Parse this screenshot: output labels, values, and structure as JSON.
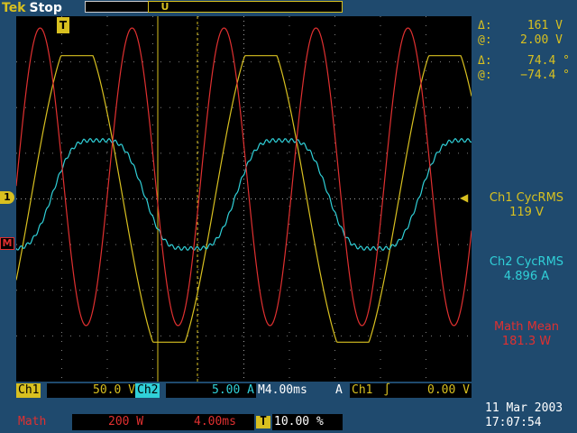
{
  "header": {
    "brand": "Tek",
    "state": "Stop",
    "trigger_position_marker": "U"
  },
  "markers": {
    "trigger": "T",
    "ch1_ground": "1",
    "math_ground": "M"
  },
  "cursors": {
    "delta_voltage_symbol": "Δ:",
    "delta_voltage": "161 V",
    "at_voltage_symbol": "@:",
    "at_voltage": "2.00 V",
    "delta_phase_symbol": "Δ:",
    "delta_phase": "74.4 °",
    "at_phase_symbol": "@:",
    "at_phase": "−74.4 °"
  },
  "measurements": [
    {
      "label": "Ch1 CycRMS",
      "value": "119 V",
      "color": "#d8c020"
    },
    {
      "label": "Ch2 CycRMS",
      "value": "4.896 A",
      "color": "#30d0d8"
    },
    {
      "label": "Math Mean",
      "value": "181.3 W",
      "color": "#e03030"
    }
  ],
  "channel_bar": {
    "ch1_label": "Ch1",
    "ch1_scale": "50.0 V",
    "ch2_label": "Ch2",
    "ch2_scale": "5.00 A",
    "timebase": "M4.00ms",
    "coupling": "A",
    "trig_source": "Ch1",
    "trig_slope": "∫",
    "trig_level": "0.00 V"
  },
  "math_bar": {
    "label": "Math",
    "scale": "200 W",
    "timebase": "4.00ms",
    "trigger_icon": "T",
    "trigger_pos": "10.00 %"
  },
  "date": "11 Mar  2003",
  "time": "17:07:54",
  "colors": {
    "ch1": "#d8c020",
    "ch2": "#30d0d8",
    "math": "#e03030",
    "grid": "#a0a0a0",
    "background": "#1f4a6e"
  }
}
